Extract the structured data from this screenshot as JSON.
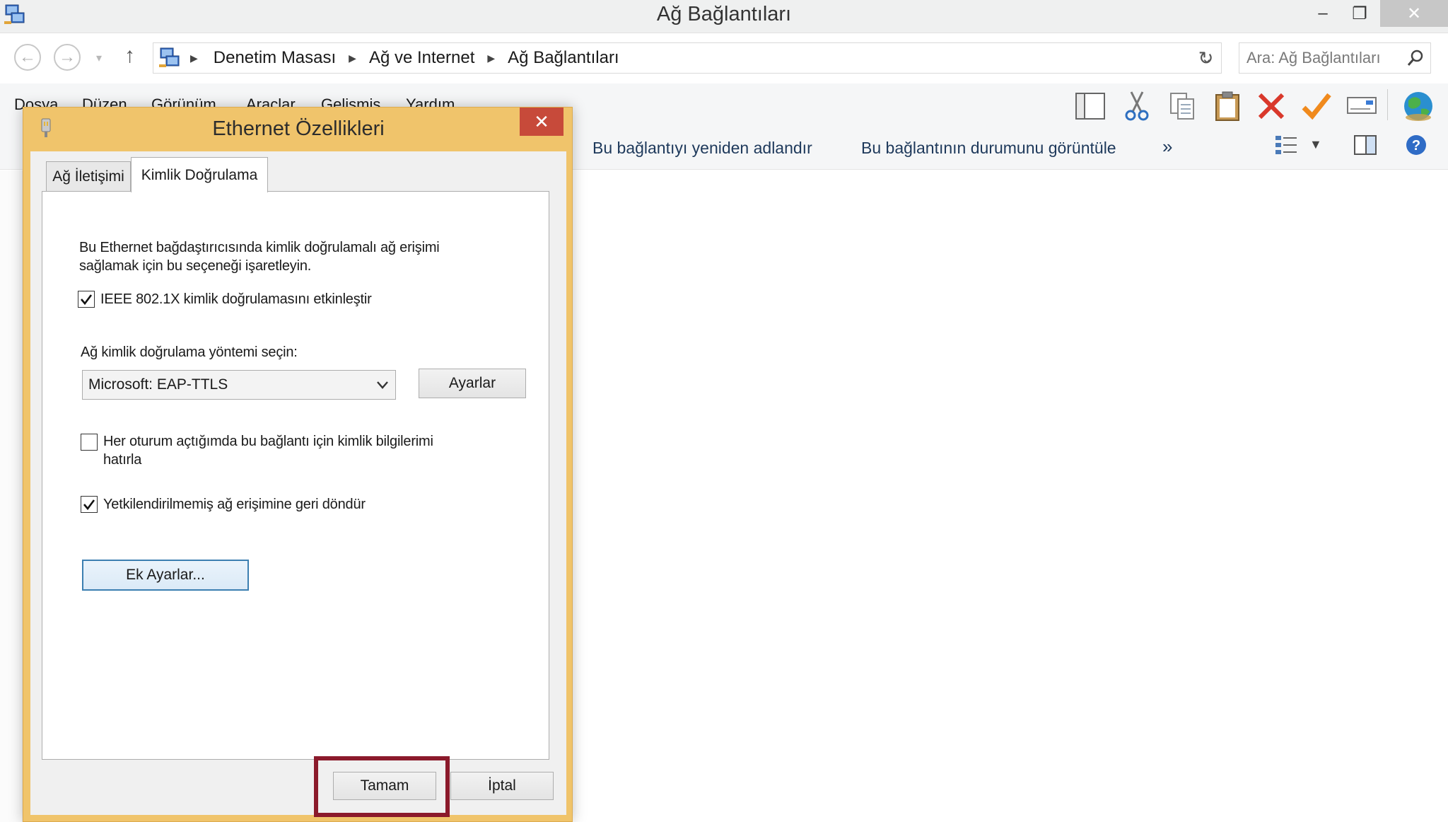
{
  "window": {
    "title": "Ağ Bağlantıları",
    "minimize": "–",
    "restore": "❐",
    "close": "✕"
  },
  "address": {
    "breadcrumbs": [
      "Denetim Masası",
      "Ağ ve Internet",
      "Ağ Bağlantıları"
    ],
    "search_placeholder": "Ara: Ağ Bağlantıları"
  },
  "menu": {
    "items": [
      "Dosya",
      "Düzen",
      "Görünüm",
      "Araçlar",
      "Gelişmiş",
      "Yardım"
    ]
  },
  "commands": {
    "rename": "Bu bağlantıyı yeniden adlandır",
    "status": "Bu bağlantının durumunu görüntüle",
    "more": "»"
  },
  "dialog": {
    "title": "Ethernet Özellikleri",
    "close": "✕",
    "tabs": [
      "Ağ İletişimi",
      "Kimlik Doğrulama"
    ],
    "active_tab": "Kimlik Doğrulama",
    "intro_line1": "Bu Ethernet bağdaştırıcısında kimlik doğrulamalı ağ erişimi",
    "intro_line2": "sağlamak için bu seçeneği işaretleyin.",
    "enable_8021x": {
      "label": "IEEE 802.1X kimlik doğrulamasını etkinleştir",
      "checked": true
    },
    "method_label": "Ağ kimlik doğrulama yöntemi seçin:",
    "method_value": "Microsoft: EAP-TTLS",
    "settings_button": "Ayarlar",
    "remember_creds": {
      "line1": "Her oturum açtığımda bu bağlantı için kimlik bilgilerimi",
      "line2": "hatırla",
      "checked": false
    },
    "fallback": {
      "label": "Yetkilendirilmemiş ağ erişimine geri döndür",
      "checked": true
    },
    "advanced_button": "Ek Ayarlar...",
    "ok_button": "Tamam",
    "cancel_button": "İptal"
  },
  "colors": {
    "dialog_frame": "#f0c46b",
    "dialog_close": "#c74a3a",
    "highlight_box": "#8b1a2b",
    "command_text": "#1e395b"
  },
  "icons": [
    "network-connections-icon",
    "back-icon",
    "forward-icon",
    "up-arrow-icon",
    "refresh-icon",
    "search-icon",
    "layout-pane-icon",
    "cut-icon",
    "copy-icon",
    "paste-icon",
    "delete-icon",
    "checkmark-icon",
    "properties-icon",
    "globe-icon",
    "view-options-icon",
    "preview-pane-icon",
    "help-icon",
    "ethernet-icon"
  ]
}
